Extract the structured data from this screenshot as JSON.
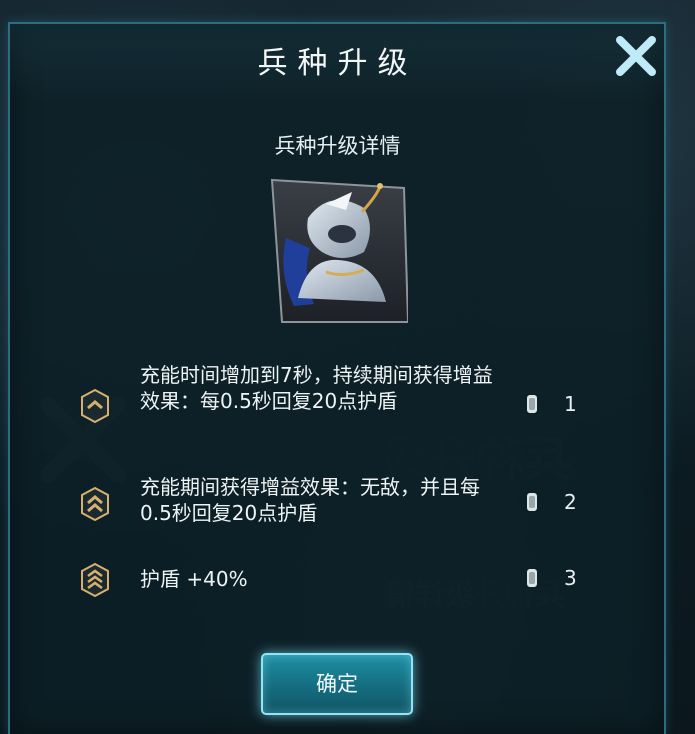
{
  "dialog": {
    "title": "兵种升级",
    "subtitle": "兵种升级详情",
    "close_icon": "close-x-icon",
    "confirm_label": "确定"
  },
  "perks": [
    {
      "description": "充能时间增加到7秒，持续期间获得增益效果：每0.5秒回复20点护盾",
      "level": "1",
      "rank_icon": "rank-chevron-1-icon"
    },
    {
      "description": "充能期间获得增益效果：无敌，并且每0.5秒回复20点护盾",
      "level": "2",
      "rank_icon": "rank-chevron-2-icon"
    },
    {
      "description": "护盾 +40%",
      "level": "3",
      "rank_icon": "rank-chevron-3-icon"
    }
  ],
  "colors": {
    "panel_border": "#2b6d80",
    "accent_cyan": "#8ee6f8",
    "rank_gold": "#d7b070",
    "close_icon": "#bfeaf7"
  }
}
